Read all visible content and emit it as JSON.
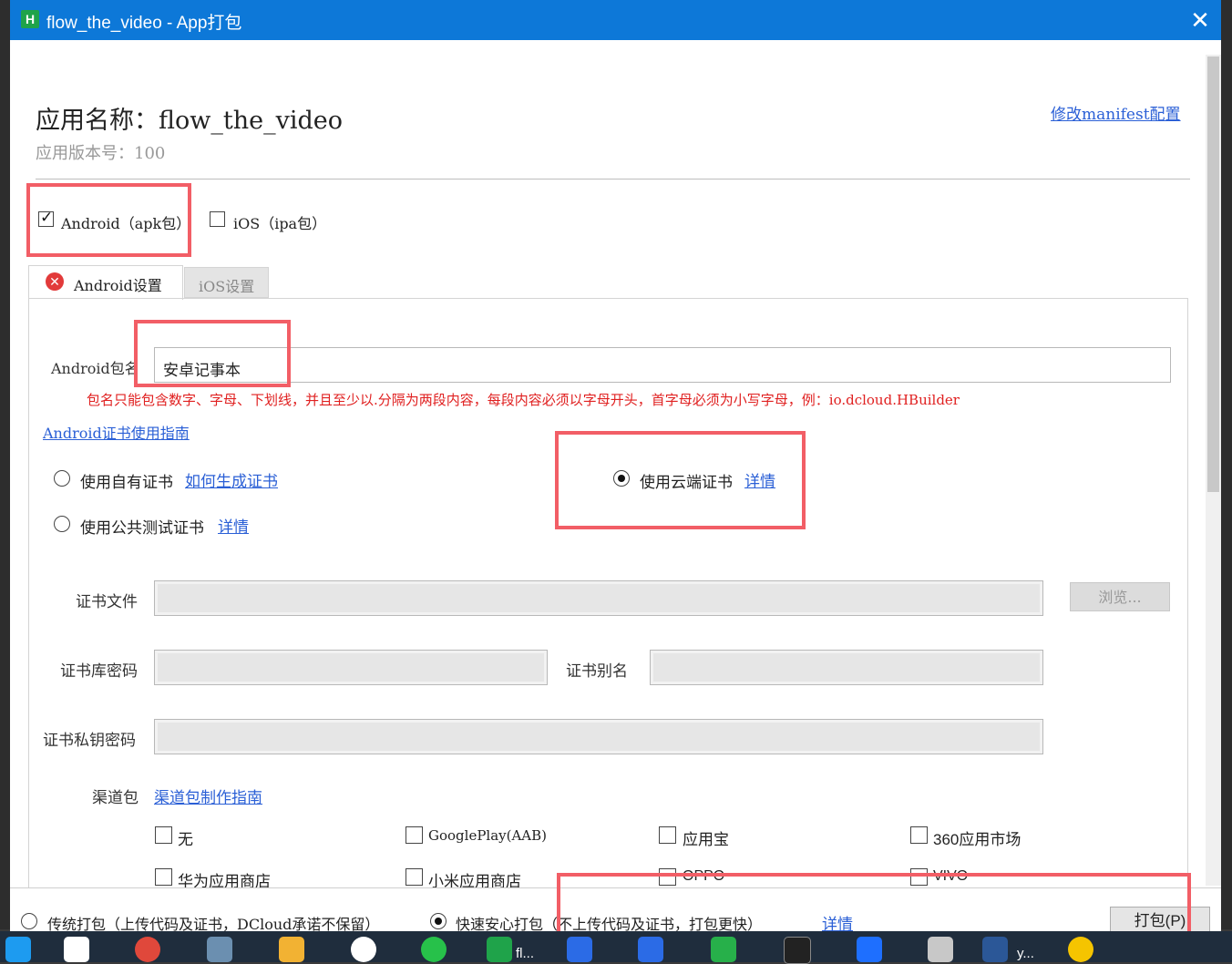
{
  "window": {
    "title": "flow_the_video - App打包",
    "app_icon_letter": "H",
    "close_glyph": "✕"
  },
  "header": {
    "app_name": "应用名称：flow_the_video",
    "app_version": "应用版本号：100",
    "manifest_link": "修改manifest配置"
  },
  "platforms": {
    "android": {
      "label": "Android（apk包）",
      "checked": true
    },
    "ios": {
      "label": "iOS（ipa包）",
      "checked": false
    }
  },
  "tabs": [
    {
      "label": "Android设置",
      "active": true,
      "error": true
    },
    {
      "label": "iOS设置",
      "active": false
    }
  ],
  "android": {
    "package_label": "Android包名",
    "package_value": "安卓记事本",
    "package_hint": "包名只能包含数字、字母、下划线，并且至少以.分隔为两段内容，每段内容必须以字母开头，首字母必须为小写字母，例：io.dcloud.HBuilder",
    "cert_guide_link": "Android证书使用指南",
    "cert_options": {
      "own": {
        "label": "使用自有证书",
        "link": "如何生成证书",
        "checked": false
      },
      "cloud": {
        "label": "使用云端证书",
        "link": "详情",
        "checked": true
      },
      "public_test": {
        "label": "使用公共测试证书",
        "link": "详情",
        "checked": false
      }
    },
    "cert_file_label": "证书文件",
    "browse_button": "浏览...",
    "keystore_password_label": "证书库密码",
    "alias_label": "证书别名",
    "private_key_password_label": "证书私钥密码",
    "channel_label": "渠道包",
    "channel_guide_link": "渠道包制作指南",
    "channels": [
      "无",
      "GooglePlay(AAB)",
      "应用宝",
      "360应用市场",
      "华为应用商店",
      "小米应用商店",
      "OPPO",
      "VIVO"
    ]
  },
  "bottom": {
    "traditional": {
      "label": "传统打包（上传代码及证书，DCloud承诺不保留）",
      "checked": false
    },
    "fast": {
      "label": "快速安心打包（不上传代码及证书，打包更快）",
      "checked": true
    },
    "detail_link": "详情",
    "pack_button": "打包(P)"
  },
  "colors": {
    "titlebar": "#0d78d8",
    "link": "#2a5fd6",
    "error_text": "#e02020",
    "highlight_box": "#f25e66"
  },
  "taskbar": {
    "icons": [
      "app-icon-1",
      "cloud-icon",
      "chrome-icon",
      "monitor-icon",
      "folder-icon",
      "qq-icon",
      "wechat-icon",
      "hbuilder-icon",
      "app-icon-2",
      "app-icon-3",
      "terminal-icon",
      "feishu-icon",
      "file-icon",
      "word-icon",
      "app-icon-4"
    ],
    "hbuilder_label": "fl...",
    "word_label": "y..."
  }
}
